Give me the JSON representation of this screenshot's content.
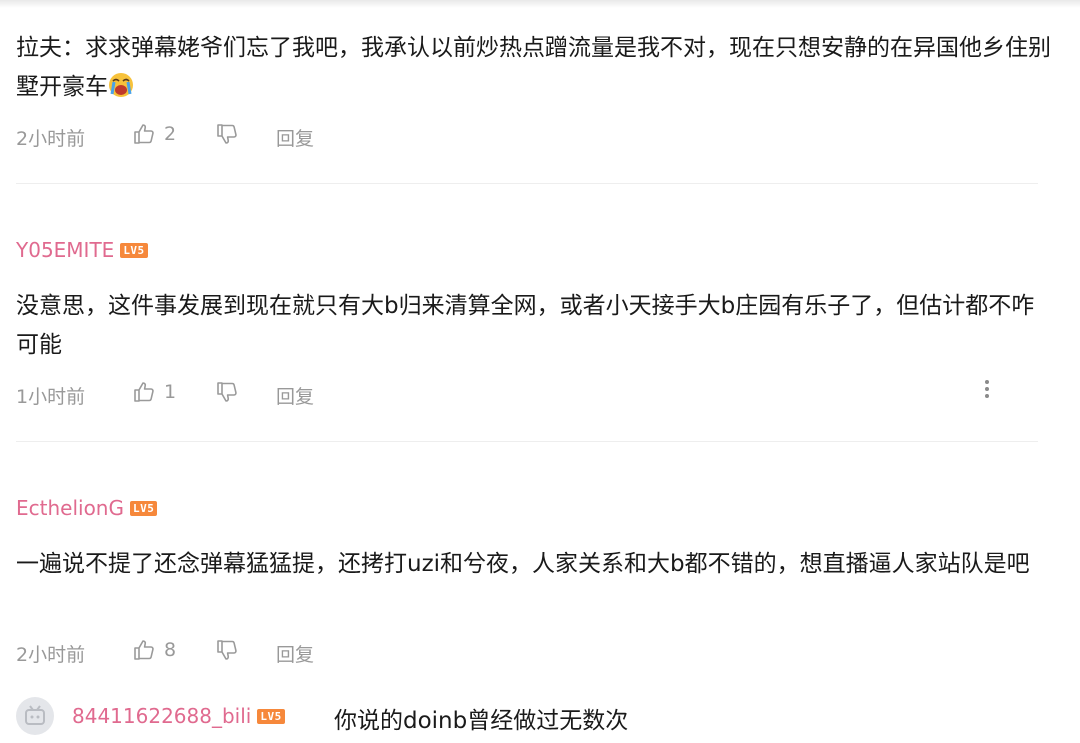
{
  "comments": [
    {
      "content": "拉夫：求求弹幕姥爷们忘了我吧，我承认以前炒热点蹭流量是我不对，现在只想安静的在异国他乡住别墅开豪车",
      "emoji": "crying-face",
      "time": "2小时前",
      "likes": "2",
      "reply_label": "回复"
    },
    {
      "username": "Y05EMITE",
      "level": "LV5",
      "content": "没意思，这件事发展到现在就只有大b归来清算全网，或者小天接手大b庄园有乐子了，但估计都不咋可能",
      "time": "1小时前",
      "likes": "1",
      "reply_label": "回复"
    },
    {
      "username": "EcthelionG",
      "level": "LV5",
      "content": "一遍说不提了还念弹幕猛猛提，还拷打uzi和兮夜，人家关系和大b都不错的，想直播逼人家站队是吧",
      "time": "2小时前",
      "likes": "8",
      "reply_label": "回复"
    }
  ],
  "sub_reply": {
    "username": "84411622688_bili",
    "level": "LV5",
    "content": "你说的doinb曾经做过无数次"
  },
  "colors": {
    "username": "#e06a8f",
    "level_badge": "#f6883b",
    "meta_text": "#999999",
    "divider": "#eeeeee"
  },
  "icons": [
    "thumbs-up-icon",
    "thumbs-down-icon",
    "more-vertical-icon",
    "avatar-placeholder-icon"
  ]
}
